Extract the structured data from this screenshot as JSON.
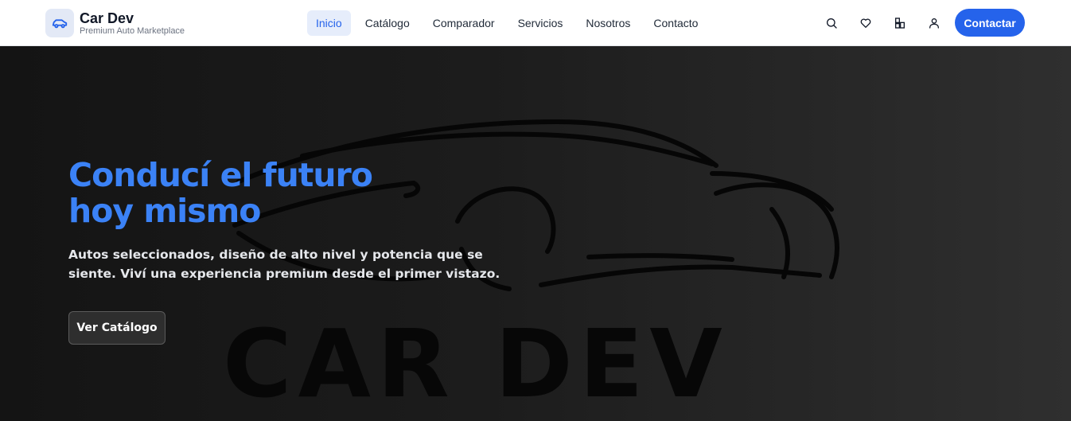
{
  "brand": {
    "name": "Car Dev",
    "tagline": "Premium Auto Marketplace",
    "icon": "car-icon"
  },
  "nav": {
    "items": [
      {
        "label": "Inicio",
        "active": true
      },
      {
        "label": "Catálogo",
        "active": false
      },
      {
        "label": "Comparador",
        "active": false
      },
      {
        "label": "Servicios",
        "active": false
      },
      {
        "label": "Nosotros",
        "active": false
      },
      {
        "label": "Contacto",
        "active": false
      }
    ],
    "icons": [
      "search-icon",
      "heart-icon",
      "compare-icon",
      "user-icon"
    ],
    "cta_label": "Contactar"
  },
  "hero": {
    "title_line1": "Conducí el futuro",
    "title_line2": "hoy mismo",
    "subtitle": "Autos seleccionados, diseño de alto nivel y potencia que se siente. Viví una experiencia premium desde el primer vistazo.",
    "button_label": "Ver Catálogo",
    "watermark_text": "CAR DEV"
  },
  "colors": {
    "accent": "#2563eb",
    "title": "#3b82f6",
    "hero_bg_dark": "#141414",
    "hero_bg_light": "#2f2f2f"
  }
}
